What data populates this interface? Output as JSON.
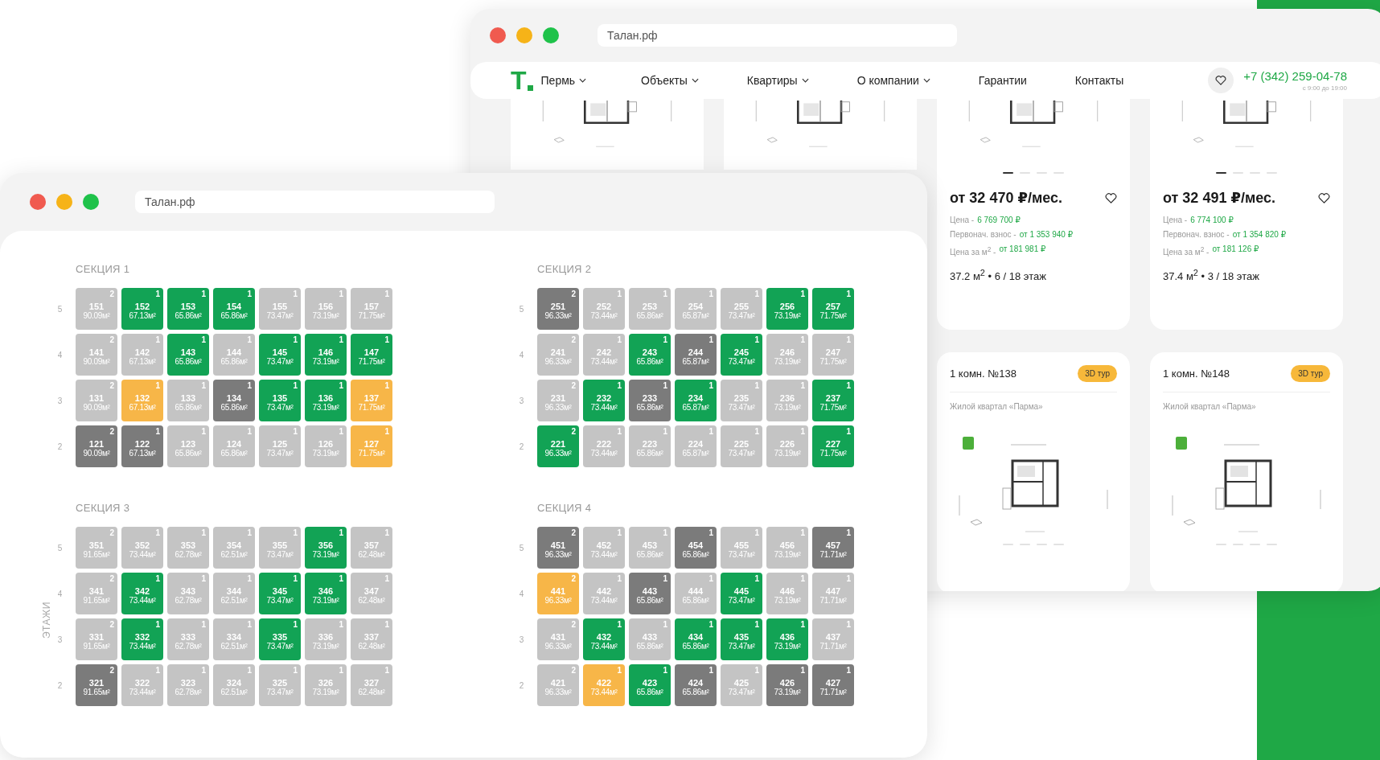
{
  "back_window": {
    "address": "Талан.рф",
    "nav": {
      "logo": "T",
      "items": [
        {
          "label": "Пермь",
          "dropdown": true
        },
        {
          "label": "Объекты",
          "dropdown": true
        },
        {
          "label": "Квартиры",
          "dropdown": true
        },
        {
          "label": "О компании",
          "dropdown": true
        },
        {
          "label": "Гарантии",
          "dropdown": false
        },
        {
          "label": "Контакты",
          "dropdown": false
        }
      ],
      "phone": "+7 (342) 259-04-78",
      "hours": "с 9:00 до 19:00"
    },
    "top_cards": [
      {
        "kind": "plan"
      },
      {
        "kind": "plan"
      },
      {
        "kind": "offer",
        "slides": [
          {
            "selected": true
          },
          {
            "selected": false
          },
          {
            "selected": false
          },
          {
            "selected": false
          }
        ],
        "price": "от 32 470 ₽/мес.",
        "details": [
          {
            "label": "Цена -",
            "value": "6 769 700 ₽"
          },
          {
            "label": "Первонач. взнос -",
            "value": "от 1 353 940 ₽"
          },
          {
            "label": "Цена за м$^{2}$ -",
            "value": "от 181 981 ₽"
          }
        ],
        "summary": "37.2 м$^{2}$ • 6 / 18 этаж"
      },
      {
        "kind": "offer",
        "slides": [
          {
            "selected": true
          },
          {
            "selected": false
          },
          {
            "selected": false
          },
          {
            "selected": false
          }
        ],
        "price": "от 32 491 ₽/мес.",
        "details": [
          {
            "label": "Цена -",
            "value": "6 774 100 ₽"
          },
          {
            "label": "Первонач. взнос -",
            "value": "от 1 354 820 ₽"
          },
          {
            "label": "Цена за м$^{2}$ -",
            "value": "от 181 126 ₽"
          }
        ],
        "summary": "37.4 м$^{2}$ • 3 / 18 этаж"
      }
    ],
    "bottom_cards": [
      {
        "title": "1 комн. №138",
        "badge": "3D тур",
        "subtitle": "Жилой квартал «Парма»",
        "slides": [
          {
            "selected": false
          },
          {
            "selected": false
          },
          {
            "selected": false
          },
          {
            "selected": false
          }
        ]
      },
      {
        "title": "1 комн. №148",
        "badge": "3D тур",
        "subtitle": "Жилой квартал «Парма»",
        "slides": [
          {
            "selected": false
          },
          {
            "selected": false
          },
          {
            "selected": false
          },
          {
            "selected": false
          }
        ]
      }
    ]
  },
  "front_window": {
    "address": "Талан.рф",
    "axis_label": "ЭТАЖИ",
    "sections": [
      {
        "title": "СЕКЦИЯ 1",
        "floors": [
          {
            "floor": "5",
            "flats": [
              {
                "no": "151",
                "area": "90.09м²",
                "rooms": "2",
                "color": "#c4c4c4"
              },
              {
                "no": "152",
                "area": "67.13м²",
                "rooms": "1",
                "color": "#12a355"
              },
              {
                "no": "153",
                "area": "65.86м²",
                "rooms": "1",
                "color": "#12a355"
              },
              {
                "no": "154",
                "area": "65.86м²",
                "rooms": "1",
                "color": "#12a355"
              },
              {
                "no": "155",
                "area": "73.47м²",
                "rooms": "1",
                "color": "#c4c4c4"
              },
              {
                "no": "156",
                "area": "73.19м²",
                "rooms": "1",
                "color": "#c4c4c4"
              },
              {
                "no": "157",
                "area": "71.75м²",
                "rooms": "1",
                "color": "#c4c4c4"
              }
            ]
          },
          {
            "floor": "4",
            "flats": [
              {
                "no": "141",
                "area": "90.09м²",
                "rooms": "2",
                "color": "#c4c4c4"
              },
              {
                "no": "142",
                "area": "67.13м²",
                "rooms": "1",
                "color": "#c4c4c4"
              },
              {
                "no": "143",
                "area": "65.86м²",
                "rooms": "1",
                "color": "#12a355"
              },
              {
                "no": "144",
                "area": "65.86м²",
                "rooms": "1",
                "color": "#c4c4c4"
              },
              {
                "no": "145",
                "area": "73.47м²",
                "rooms": "1",
                "color": "#12a355"
              },
              {
                "no": "146",
                "area": "73.19м²",
                "rooms": "1",
                "color": "#12a355"
              },
              {
                "no": "147",
                "area": "71.75м²",
                "rooms": "1",
                "color": "#12a355"
              }
            ]
          },
          {
            "floor": "3",
            "flats": [
              {
                "no": "131",
                "area": "90.09м²",
                "rooms": "2",
                "color": "#c4c4c4"
              },
              {
                "no": "132",
                "area": "67.13м²",
                "rooms": "1",
                "color": "#f7b648"
              },
              {
                "no": "133",
                "area": "65.86м²",
                "rooms": "1",
                "color": "#c4c4c4"
              },
              {
                "no": "134",
                "area": "65.86м²",
                "rooms": "1",
                "color": "#7b7b7b"
              },
              {
                "no": "135",
                "area": "73.47м²",
                "rooms": "1",
                "color": "#12a355"
              },
              {
                "no": "136",
                "area": "73.19м²",
                "rooms": "1",
                "color": "#12a355"
              },
              {
                "no": "137",
                "area": "71.75м²",
                "rooms": "1",
                "color": "#f7b648"
              }
            ]
          },
          {
            "floor": "2",
            "flats": [
              {
                "no": "121",
                "area": "90.09м²",
                "rooms": "2",
                "color": "#7b7b7b"
              },
              {
                "no": "122",
                "area": "67.13м²",
                "rooms": "1",
                "color": "#7b7b7b"
              },
              {
                "no": "123",
                "area": "65.86м²",
                "rooms": "1",
                "color": "#c4c4c4"
              },
              {
                "no": "124",
                "area": "65.86м²",
                "rooms": "1",
                "color": "#c4c4c4"
              },
              {
                "no": "125",
                "area": "73.47м²",
                "rooms": "1",
                "color": "#c4c4c4"
              },
              {
                "no": "126",
                "area": "73.19м²",
                "rooms": "1",
                "color": "#c4c4c4"
              },
              {
                "no": "127",
                "area": "71.75м²",
                "rooms": "1",
                "color": "#f7b648"
              }
            ]
          }
        ]
      },
      {
        "title": "СЕКЦИЯ 2",
        "floors": [
          {
            "floor": "5",
            "flats": [
              {
                "no": "251",
                "area": "96.33м²",
                "rooms": "2",
                "color": "#7b7b7b"
              },
              {
                "no": "252",
                "area": "73.44м²",
                "rooms": "1",
                "color": "#c4c4c4"
              },
              {
                "no": "253",
                "area": "65.86м²",
                "rooms": "1",
                "color": "#c4c4c4"
              },
              {
                "no": "254",
                "area": "65.87м²",
                "rooms": "1",
                "color": "#c4c4c4"
              },
              {
                "no": "255",
                "area": "73.47м²",
                "rooms": "1",
                "color": "#c4c4c4"
              },
              {
                "no": "256",
                "area": "73.19м²",
                "rooms": "1",
                "color": "#12a355"
              },
              {
                "no": "257",
                "area": "71.75м²",
                "rooms": "1",
                "color": "#12a355"
              }
            ]
          },
          {
            "floor": "4",
            "flats": [
              {
                "no": "241",
                "area": "96.33м²",
                "rooms": "2",
                "color": "#c4c4c4"
              },
              {
                "no": "242",
                "area": "73.44м²",
                "rooms": "1",
                "color": "#c4c4c4"
              },
              {
                "no": "243",
                "area": "65.86м²",
                "rooms": "1",
                "color": "#12a355"
              },
              {
                "no": "244",
                "area": "65.87м²",
                "rooms": "1",
                "color": "#7b7b7b"
              },
              {
                "no": "245",
                "area": "73.47м²",
                "rooms": "1",
                "color": "#12a355"
              },
              {
                "no": "246",
                "area": "73.19м²",
                "rooms": "1",
                "color": "#c4c4c4"
              },
              {
                "no": "247",
                "area": "71.75м²",
                "rooms": "1",
                "color": "#c4c4c4"
              }
            ]
          },
          {
            "floor": "3",
            "flats": [
              {
                "no": "231",
                "area": "96.33м²",
                "rooms": "2",
                "color": "#c4c4c4"
              },
              {
                "no": "232",
                "area": "73.44м²",
                "rooms": "1",
                "color": "#12a355"
              },
              {
                "no": "233",
                "area": "65.86м²",
                "rooms": "1",
                "color": "#7b7b7b"
              },
              {
                "no": "234",
                "area": "65.87м²",
                "rooms": "1",
                "color": "#12a355"
              },
              {
                "no": "235",
                "area": "73.47м²",
                "rooms": "1",
                "color": "#c4c4c4"
              },
              {
                "no": "236",
                "area": "73.19м²",
                "rooms": "1",
                "color": "#c4c4c4"
              },
              {
                "no": "237",
                "area": "71.75м²",
                "rooms": "1",
                "color": "#12a355"
              }
            ]
          },
          {
            "floor": "2",
            "flats": [
              {
                "no": "221",
                "area": "96.33м²",
                "rooms": "2",
                "color": "#12a355"
              },
              {
                "no": "222",
                "area": "73.44м²",
                "rooms": "1",
                "color": "#c4c4c4"
              },
              {
                "no": "223",
                "area": "65.86м²",
                "rooms": "1",
                "color": "#c4c4c4"
              },
              {
                "no": "224",
                "area": "65.87м²",
                "rooms": "1",
                "color": "#c4c4c4"
              },
              {
                "no": "225",
                "area": "73.47м²",
                "rooms": "1",
                "color": "#c4c4c4"
              },
              {
                "no": "226",
                "area": "73.19м²",
                "rooms": "1",
                "color": "#c4c4c4"
              },
              {
                "no": "227",
                "area": "71.75м²",
                "rooms": "1",
                "color": "#12a355"
              }
            ]
          }
        ]
      },
      {
        "title": "СЕКЦИЯ 3",
        "floors": [
          {
            "floor": "5",
            "flats": [
              {
                "no": "351",
                "area": "91.65м²",
                "rooms": "2",
                "color": "#c4c4c4"
              },
              {
                "no": "352",
                "area": "73.44м²",
                "rooms": "1",
                "color": "#c4c4c4"
              },
              {
                "no": "353",
                "area": "62.78м²",
                "rooms": "1",
                "color": "#c4c4c4"
              },
              {
                "no": "354",
                "area": "62.51м²",
                "rooms": "1",
                "color": "#c4c4c4"
              },
              {
                "no": "355",
                "area": "73.47м²",
                "rooms": "1",
                "color": "#c4c4c4"
              },
              {
                "no": "356",
                "area": "73.19м²",
                "rooms": "1",
                "color": "#12a355"
              },
              {
                "no": "357",
                "area": "62.48м²",
                "rooms": "1",
                "color": "#c4c4c4"
              }
            ]
          },
          {
            "floor": "4",
            "flats": [
              {
                "no": "341",
                "area": "91.65м²",
                "rooms": "2",
                "color": "#c4c4c4"
              },
              {
                "no": "342",
                "area": "73.44м²",
                "rooms": "1",
                "color": "#12a355"
              },
              {
                "no": "343",
                "area": "62.78м²",
                "rooms": "1",
                "color": "#c4c4c4"
              },
              {
                "no": "344",
                "area": "62.51м²",
                "rooms": "1",
                "color": "#c4c4c4"
              },
              {
                "no": "345",
                "area": "73.47м²",
                "rooms": "1",
                "color": "#12a355"
              },
              {
                "no": "346",
                "area": "73.19м²",
                "rooms": "1",
                "color": "#12a355"
              },
              {
                "no": "347",
                "area": "62.48м²",
                "rooms": "1",
                "color": "#c4c4c4"
              }
            ]
          },
          {
            "floor": "3",
            "flats": [
              {
                "no": "331",
                "area": "91.65м²",
                "rooms": "2",
                "color": "#c4c4c4"
              },
              {
                "no": "332",
                "area": "73.44м²",
                "rooms": "1",
                "color": "#12a355"
              },
              {
                "no": "333",
                "area": "62.78м²",
                "rooms": "1",
                "color": "#c4c4c4"
              },
              {
                "no": "334",
                "area": "62.51м²",
                "rooms": "1",
                "color": "#c4c4c4"
              },
              {
                "no": "335",
                "area": "73.47м²",
                "rooms": "1",
                "color": "#12a355"
              },
              {
                "no": "336",
                "area": "73.19м²",
                "rooms": "1",
                "color": "#c4c4c4"
              },
              {
                "no": "337",
                "area": "62.48м²",
                "rooms": "1",
                "color": "#c4c4c4"
              }
            ]
          },
          {
            "floor": "2",
            "flats": [
              {
                "no": "321",
                "area": "91.65м²",
                "rooms": "2",
                "color": "#7b7b7b"
              },
              {
                "no": "322",
                "area": "73.44м²",
                "rooms": "1",
                "color": "#c4c4c4"
              },
              {
                "no": "323",
                "area": "62.78м²",
                "rooms": "1",
                "color": "#c4c4c4"
              },
              {
                "no": "324",
                "area": "62.51м²",
                "rooms": "1",
                "color": "#c4c4c4"
              },
              {
                "no": "325",
                "area": "73.47м²",
                "rooms": "1",
                "color": "#c4c4c4"
              },
              {
                "no": "326",
                "area": "73.19м²",
                "rooms": "1",
                "color": "#c4c4c4"
              },
              {
                "no": "327",
                "area": "62.48м²",
                "rooms": "1",
                "color": "#c4c4c4"
              }
            ]
          }
        ]
      },
      {
        "title": "СЕКЦИЯ 4",
        "floors": [
          {
            "floor": "5",
            "flats": [
              {
                "no": "451",
                "area": "96.33м²",
                "rooms": "2",
                "color": "#7b7b7b"
              },
              {
                "no": "452",
                "area": "73.44м²",
                "rooms": "1",
                "color": "#c4c4c4"
              },
              {
                "no": "453",
                "area": "65.86м²",
                "rooms": "1",
                "color": "#c4c4c4"
              },
              {
                "no": "454",
                "area": "65.86м²",
                "rooms": "1",
                "color": "#7b7b7b"
              },
              {
                "no": "455",
                "area": "73.47м²",
                "rooms": "1",
                "color": "#c4c4c4"
              },
              {
                "no": "456",
                "area": "73.19м²",
                "rooms": "1",
                "color": "#c4c4c4"
              },
              {
                "no": "457",
                "area": "71.71м²",
                "rooms": "1",
                "color": "#7b7b7b"
              }
            ]
          },
          {
            "floor": "4",
            "flats": [
              {
                "no": "441",
                "area": "96.33м²",
                "rooms": "2",
                "color": "#f7b648"
              },
              {
                "no": "442",
                "area": "73.44м²",
                "rooms": "1",
                "color": "#c4c4c4"
              },
              {
                "no": "443",
                "area": "65.86м²",
                "rooms": "1",
                "color": "#7b7b7b"
              },
              {
                "no": "444",
                "area": "65.86м²",
                "rooms": "1",
                "color": "#c4c4c4"
              },
              {
                "no": "445",
                "area": "73.47м²",
                "rooms": "1",
                "color": "#12a355"
              },
              {
                "no": "446",
                "area": "73.19м²",
                "rooms": "1",
                "color": "#c4c4c4"
              },
              {
                "no": "447",
                "area": "71.71м²",
                "rooms": "1",
                "color": "#c4c4c4"
              }
            ]
          },
          {
            "floor": "3",
            "flats": [
              {
                "no": "431",
                "area": "96.33м²",
                "rooms": "2",
                "color": "#c4c4c4"
              },
              {
                "no": "432",
                "area": "73.44м²",
                "rooms": "1",
                "color": "#12a355"
              },
              {
                "no": "433",
                "area": "65.86м²",
                "rooms": "1",
                "color": "#c4c4c4"
              },
              {
                "no": "434",
                "area": "65.86м²",
                "rooms": "1",
                "color": "#12a355"
              },
              {
                "no": "435",
                "area": "73.47м²",
                "rooms": "1",
                "color": "#12a355"
              },
              {
                "no": "436",
                "area": "73.19м²",
                "rooms": "1",
                "color": "#12a355"
              },
              {
                "no": "437",
                "area": "71.71м²",
                "rooms": "1",
                "color": "#c4c4c4"
              }
            ]
          },
          {
            "floor": "2",
            "flats": [
              {
                "no": "421",
                "area": "96.33м²",
                "rooms": "2",
                "color": "#c4c4c4"
              },
              {
                "no": "422",
                "area": "73.44м²",
                "rooms": "1",
                "color": "#f7b648"
              },
              {
                "no": "423",
                "area": "65.86м²",
                "rooms": "1",
                "color": "#12a355"
              },
              {
                "no": "424",
                "area": "65.86м²",
                "rooms": "1",
                "color": "#7b7b7b"
              },
              {
                "no": "425",
                "area": "73.47м²",
                "rooms": "1",
                "color": "#c4c4c4"
              },
              {
                "no": "426",
                "area": "73.19м²",
                "rooms": "1",
                "color": "#7b7b7b"
              },
              {
                "no": "427",
                "area": "71.71м²",
                "rooms": "1",
                "color": "#7b7b7b"
              }
            ]
          }
        ]
      }
    ]
  }
}
